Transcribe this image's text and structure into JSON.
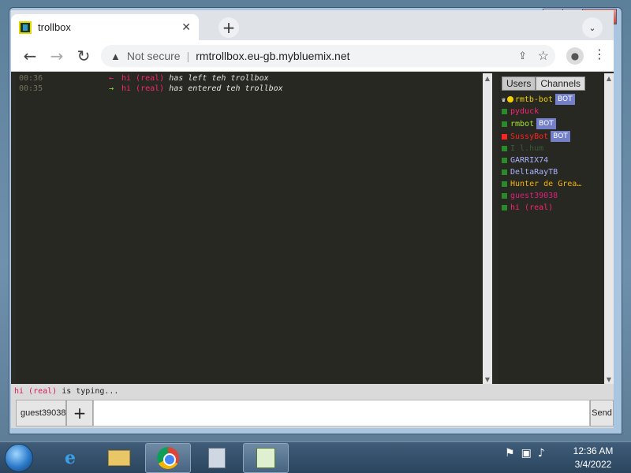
{
  "browser": {
    "tab_title": "trollbox",
    "tab_close": "✕",
    "new_tab": "+",
    "security_label": "Not secure",
    "url": "rmtrollbox.eu-gb.mybluemix.net",
    "window_controls": {
      "minimize": "▁",
      "maximize": "▢",
      "close": "✕"
    }
  },
  "chat": {
    "messages": [
      {
        "time": "00:36",
        "arrow": "←",
        "nick": "hi (real)",
        "text": "has left teh trollbox"
      },
      {
        "time": "00:35",
        "arrow": "→",
        "nick": "hi (real)",
        "text": "has entered teh trollbox"
      }
    ]
  },
  "panel": {
    "tabs": [
      "Users",
      "Channels"
    ],
    "users": [
      {
        "name": "rmtb-bot",
        "color": "#f4d000",
        "bot": true,
        "status": "owner"
      },
      {
        "name": "pyduck",
        "color": "#f92672",
        "bot": false,
        "status": "online"
      },
      {
        "name": "rmbot",
        "color": "#a6e22e",
        "bot": true,
        "status": "online"
      },
      {
        "name": "SussyBot",
        "color": "#ff2222",
        "bot": true,
        "status": "busy"
      },
      {
        "name": "I l.hum",
        "color": "#3a5a3a",
        "bot": false,
        "status": "online"
      },
      {
        "name": "GARRIX74",
        "color": "#a9b3ff",
        "bot": false,
        "status": "online"
      },
      {
        "name": "DeltaRayTB",
        "color": "#a9b3ff",
        "bot": false,
        "status": "online"
      },
      {
        "name": "Hunter de Grea…",
        "color": "#f4b400",
        "bot": false,
        "status": "online"
      },
      {
        "name": "guest39038",
        "color": "#e0207a",
        "bot": false,
        "status": "online"
      },
      {
        "name": "hi (real)",
        "color": "#f92672",
        "bot": false,
        "status": "online"
      }
    ],
    "bot_label": "BOT"
  },
  "typing": {
    "nick": "hi (real)",
    "text": "is typing..."
  },
  "input": {
    "nick": "guest39038",
    "plus": "+",
    "send": "Send"
  },
  "taskbar": {
    "time": "12:36 AM",
    "date": "3/4/2022"
  }
}
